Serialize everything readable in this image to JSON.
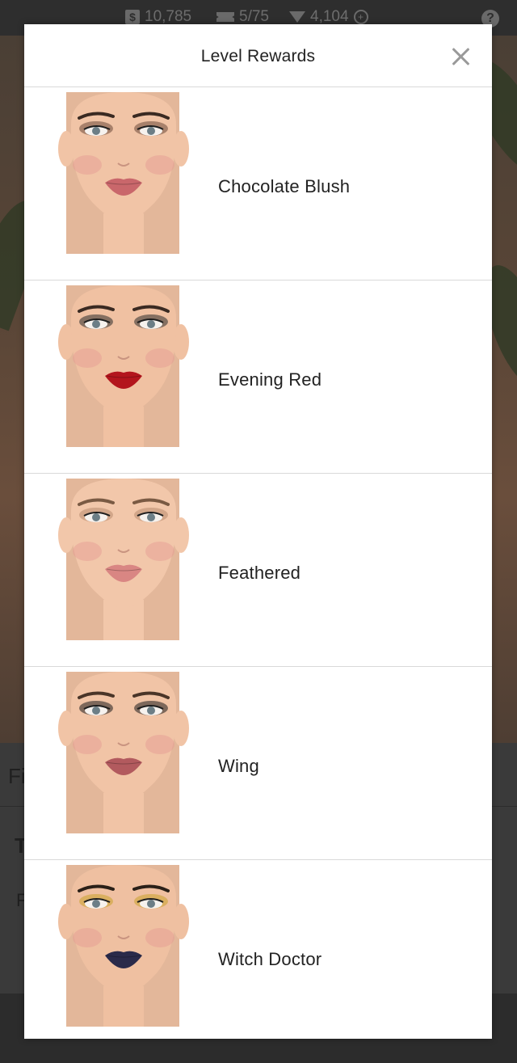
{
  "status_bar": {
    "coins": "10,785",
    "tickets": "5/75",
    "diamonds": "4,104"
  },
  "modal": {
    "title": "Level Rewards",
    "items": [
      {
        "label": "Chocolate Blush",
        "lip_color": "#c9676b",
        "shadow_color": "#6b4a3a",
        "brow_color": "#3a2a22",
        "skin": "#f1c4a6"
      },
      {
        "label": "Evening Red",
        "lip_color": "#b3151d",
        "shadow_color": "#2b2b2b",
        "brow_color": "#3a2a22",
        "skin": "#f0c1a2"
      },
      {
        "label": "Feathered",
        "lip_color": "#d98683",
        "shadow_color": "#b88a6e",
        "brow_color": "#7a5a43",
        "skin": "#f2c7aa"
      },
      {
        "label": "Wing",
        "lip_color": "#b25a5e",
        "shadow_color": "#1d1d1d",
        "brow_color": "#4a3528",
        "skin": "#f1c4a6"
      },
      {
        "label": "Witch Doctor",
        "lip_color": "#2a2a4a",
        "shadow_color": "#c9a02c",
        "brow_color": "#2a2018",
        "skin": "#efc0a1"
      }
    ]
  },
  "background": {
    "fragment_1": "Fi",
    "fragment_2": "T",
    "fragment_3": "F"
  }
}
